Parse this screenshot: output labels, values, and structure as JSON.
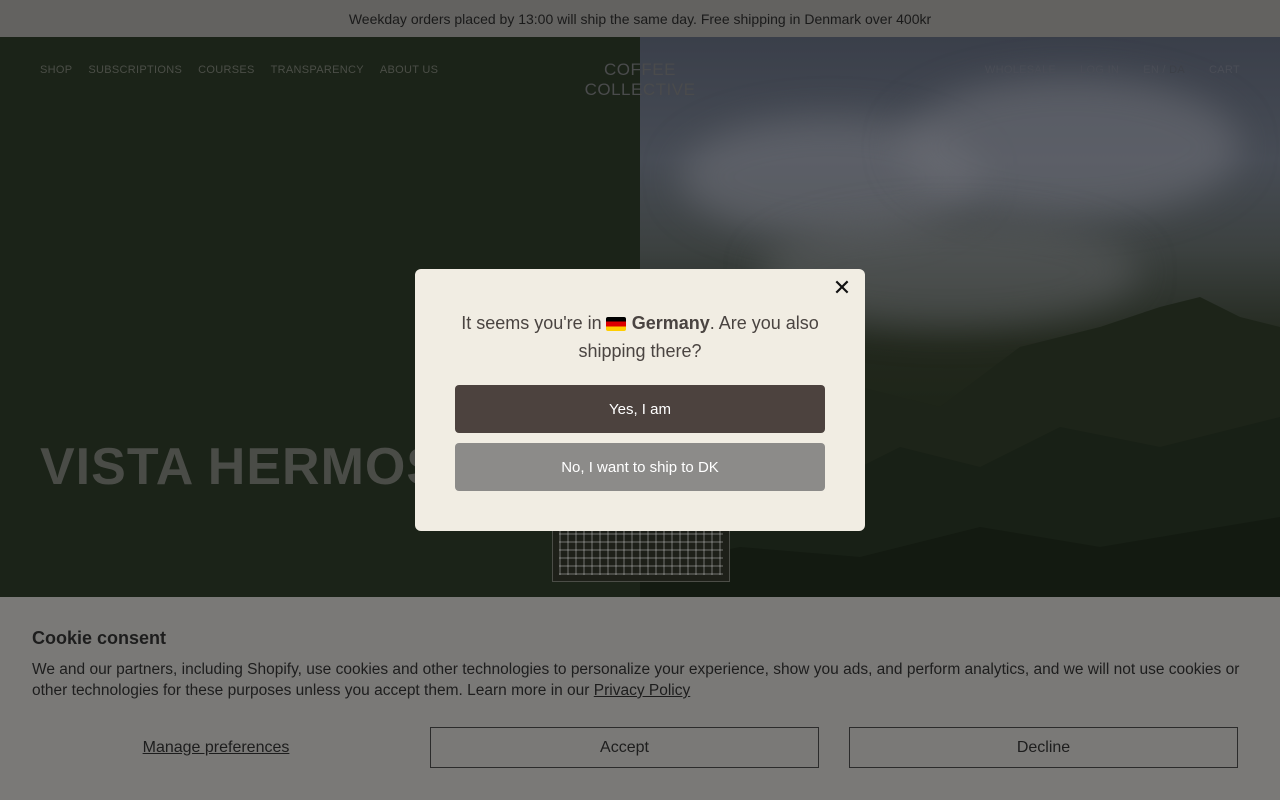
{
  "announcement": "Weekday orders placed by 13:00 will ship the same day. Free shipping in Denmark over 400kr",
  "nav": {
    "left": [
      "SHOP",
      "SUBSCRIPTIONS",
      "COURSES",
      "TRANSPARENCY",
      "ABOUT US"
    ],
    "logo": "COFFEE COLLECTIVE",
    "wholesale": "WHOLESALE",
    "login": "LOG IN",
    "lang_en": "EN",
    "lang_sep": " / ",
    "lang_da": "DA",
    "cart": "CART"
  },
  "hero": {
    "title": "VISTA HERMOSA"
  },
  "modal": {
    "text_before": "It seems you're in",
    "country": "Germany",
    "text_after": ". Are you also shipping there?",
    "yes_label": "Yes, I am",
    "no_label": "No, I want to ship to DK",
    "close_icon": "close-icon"
  },
  "cookie": {
    "title": "Cookie consent",
    "body": "We and our partners, including Shopify, use cookies and other technologies to personalize your experience, show you ads, and perform analytics, and we will not use cookies or other technologies for these purposes unless you accept them. Learn more in our ",
    "privacy_link": "Privacy Policy",
    "manage_label": "Manage preferences",
    "accept_label": "Accept",
    "decline_label": "Decline"
  },
  "colors": {
    "modal_bg": "#f1ede3",
    "yes_button": "#4c423e",
    "no_button": "#8c8b89",
    "overlay_tint": "#7a7977"
  }
}
